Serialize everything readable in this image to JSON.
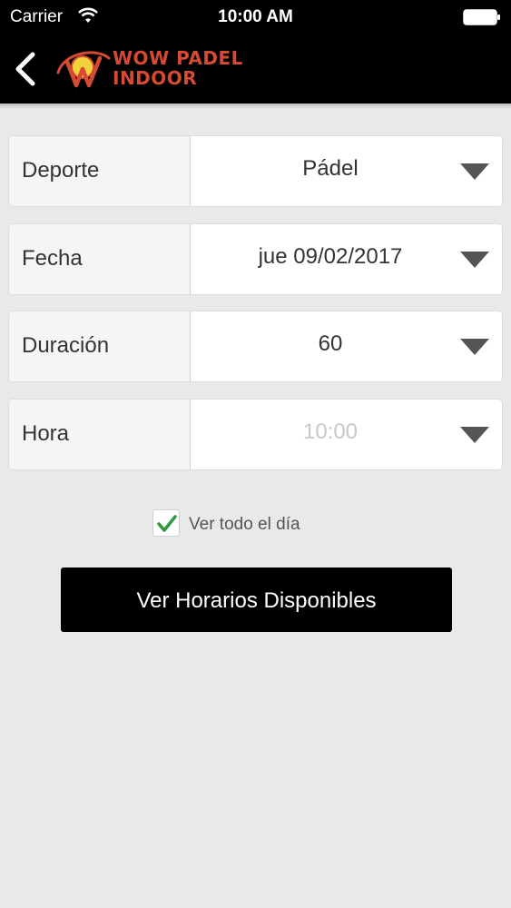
{
  "status_bar": {
    "carrier": "Carrier",
    "time": "10:00 AM",
    "icons": [
      "wifi-icon",
      "battery-icon"
    ]
  },
  "nav_bar": {
    "back_icon": "chevron-left-icon",
    "logo_line1": "WOW PADEL",
    "logo_line2": "INDOOR",
    "brand_color": "#d54a32"
  },
  "form": {
    "rows": [
      {
        "label": "Deporte",
        "value": "Pádel",
        "placeholder": false
      },
      {
        "label": "Fecha",
        "value": "jue 09/02/2017",
        "placeholder": false
      },
      {
        "label": "Duración",
        "value": "60",
        "placeholder": false
      },
      {
        "label": "Hora",
        "value": "10:00",
        "placeholder": true
      }
    ],
    "dropdown_icon": "chevron-down-icon"
  },
  "all_day": {
    "label": "Ver todo el día",
    "checked": true,
    "check_color": "#2e9a3f"
  },
  "submit": {
    "label": "Ver Horarios Disponibles"
  }
}
